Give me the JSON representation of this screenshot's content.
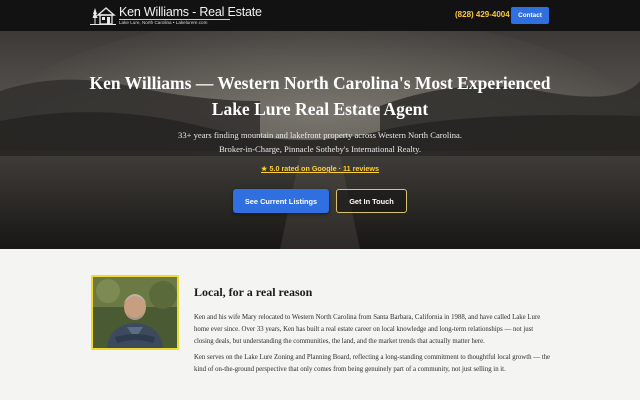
{
  "header": {
    "logo": {
      "title": "Ken Williams - Real Estate",
      "tagline": "Lake Lure, North Carolina • Lakelurere.com"
    },
    "phone": "(828) 429-4004",
    "contact_label": "Contact",
    "icons": {
      "logo": "house-with-trees-icon"
    }
  },
  "hero": {
    "title_line1": "Ken Williams — Western North Carolina's Most Experienced",
    "title_line2": "Lake Lure Real Estate Agent",
    "subtitle_line1": "33+ years finding mountain and lakefront property across Western North Carolina.",
    "subtitle_line2": "Broker-in-Charge, Pinnacle Sotheby's International Realty.",
    "rating": "★ 5.0 rated on Google · 11 reviews",
    "primary_button": "See Current Listings",
    "secondary_button": "Get In Touch"
  },
  "about": {
    "heading": "Local, for a real reason",
    "paragraph1": "Ken and his wife Mary relocated to Western North Carolina from Santa Barbara, California in 1988, and have called Lake Lure home ever since. Over 33 years, Ken has built a real estate career on local knowledge and long-term relationships — not just closing deals, but understanding the communities, the land, and the market trends that actually matter here.",
    "paragraph2": "Ken serves on the Lake Lure Zoning and Planning Board, reflecting a long-standing commitment to thoughtful local growth — the kind of on-the-ground perspective that only comes from being genuinely part of a community, not just selling in it."
  },
  "colors": {
    "header_bg": "#121212",
    "accent_blue": "#2f6fe0",
    "phone_gold": "#ffc83a",
    "rating_gold": "#ffd035",
    "portrait_border": "#f0d92a",
    "section_bg": "#f4f4f2"
  }
}
